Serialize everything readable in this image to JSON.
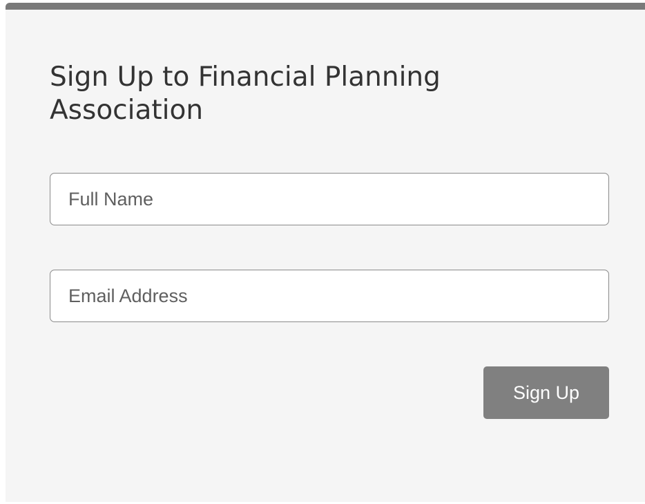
{
  "form": {
    "title": "Sign Up to Financial Planning Association",
    "full_name": {
      "placeholder": "Full Name",
      "value": ""
    },
    "email": {
      "placeholder": "Email Address",
      "value": ""
    },
    "submit_label": "Sign Up"
  },
  "colors": {
    "card_background": "#f5f5f5",
    "top_border": "#7a7a7a",
    "button_background": "#808080",
    "button_text": "#ffffff"
  }
}
